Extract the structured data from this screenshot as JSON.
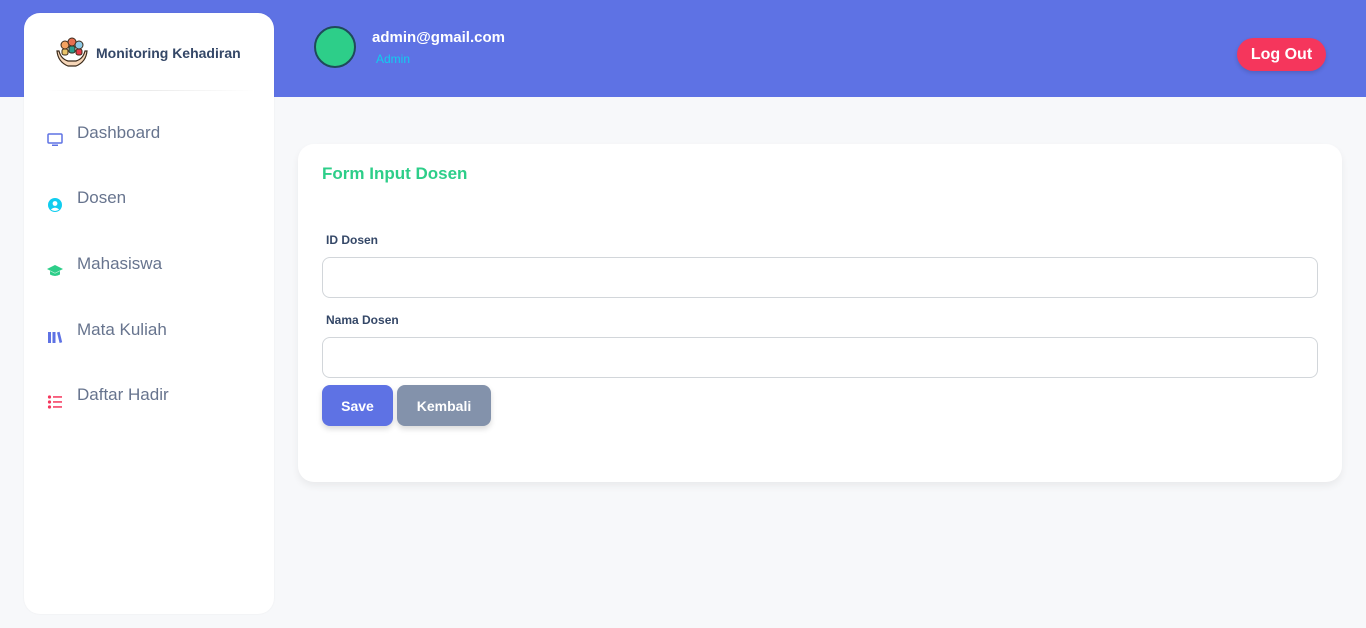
{
  "header": {
    "user_email": "admin@gmail.com",
    "user_role": "Admin",
    "logout_label": "Log Out"
  },
  "sidebar": {
    "brand": "Monitoring Kehadiran",
    "items": [
      {
        "label": "Dashboard",
        "icon": "monitor-icon",
        "color": "#5e72e4"
      },
      {
        "label": "Dosen",
        "icon": "user-circle-icon",
        "color": "#11cdef"
      },
      {
        "label": "Mahasiswa",
        "icon": "graduation-cap-icon",
        "color": "#2dce89"
      },
      {
        "label": "Mata Kuliah",
        "icon": "books-icon",
        "color": "#5e72e4"
      },
      {
        "label": "Daftar Hadir",
        "icon": "list-icon",
        "color": "#f5365c"
      }
    ]
  },
  "form": {
    "title": "Form Input Dosen",
    "fields": [
      {
        "label": "ID Dosen",
        "value": "",
        "placeholder": ""
      },
      {
        "label": "Nama Dosen",
        "value": "",
        "placeholder": ""
      }
    ],
    "save_label": "Save",
    "back_label": "Kembali"
  },
  "colors": {
    "primary": "#5e72e4",
    "success": "#2dce89",
    "danger": "#f5365c",
    "info": "#11cdef",
    "secondary": "#8392ab"
  }
}
